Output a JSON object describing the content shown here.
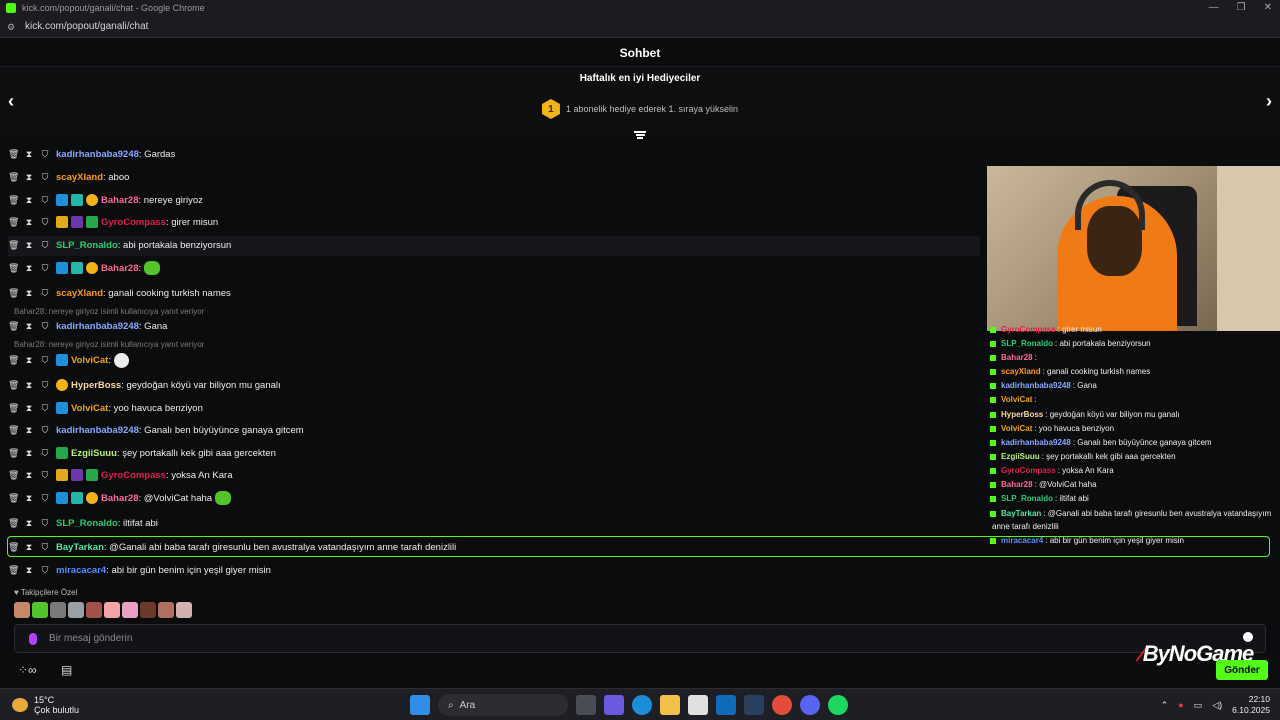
{
  "browser": {
    "window_title": "kick.com/popout/ganali/chat - Google Chrome",
    "url": "kick.com/popout/ganali/chat"
  },
  "header": {
    "title": "Sohbet"
  },
  "gifters": {
    "title": "Haftalık en iyi Hediyeciler",
    "rank": "1",
    "cta": "1 abonelik hediye ederek 1. sıraya yükselin"
  },
  "messages": [
    {
      "user": "kadirhanbaba9248",
      "color": "#8aa8ff",
      "text": ": Gardas"
    },
    {
      "user": "scayXland",
      "color": "#ff9a1f",
      "text": ": aboo"
    },
    {
      "user": "Bahar28",
      "color": "#ff6a95",
      "text": ": nereye giriyoz"
    },
    {
      "user": "GyroCompass",
      "color": "#e01e4d",
      "text": ": girer misun"
    },
    {
      "user": "SLP_Ronaldo",
      "color": "#2ecc71",
      "text": ": abi portakala benziyorsun"
    },
    {
      "user": "Bahar28",
      "color": "#ff6a95",
      "text": ":"
    },
    {
      "user": "scayXland",
      "color": "#ff9a1f",
      "text": ": ganali cooking turkish names"
    },
    {
      "user": "kadirhanbaba9248",
      "color": "#8aa8ff",
      "text": ": Gana"
    },
    {
      "user": "VolviCat",
      "color": "#f0a21a",
      "text": ":"
    },
    {
      "user": "HyperBoss",
      "color": "#ffd7a0",
      "text": ": geydoğan köyü var biliyon mu ganalı"
    },
    {
      "user": "VolviCat",
      "color": "#f0a21a",
      "text": ": yoo havuca benziyon"
    },
    {
      "user": "kadirhanbaba9248",
      "color": "#8aa8ff",
      "text": ": Ganalı ben büyüyünce ganaya gitcem"
    },
    {
      "user": "EzgiiSuuu",
      "color": "#b7f07a",
      "text": ": şey portakallı kek gibi aaa gercekten"
    },
    {
      "user": "GyroCompass",
      "color": "#e01e4d",
      "text": ": yoksa An Kara"
    },
    {
      "user": "Bahar28",
      "color": "#ff6a95",
      "text": ": @VolviCat haha"
    },
    {
      "user": "SLP_Ronaldo",
      "color": "#2ecc71",
      "text": ": iltifat abi"
    },
    {
      "user": "BayTarkan",
      "color": "#55e6a0",
      "text": ": @Ganali abi baba tarafı giresunlu ben avustralya vatandaşıyım anne tarafı denizlili"
    },
    {
      "user": "miracacar4",
      "color": "#5a8bff",
      "text": ": abi bir gün benim için yeşil giyer misin"
    }
  ],
  "replies": [
    "Bahar28: nereye giriyoz isimli kullanıcıya yanıt veriyor",
    "Bahar28: nereye giriyoz isimli kullanıcıya yanıt veriyor"
  ],
  "overlay_chat": [
    {
      "user": "GyroCompass",
      "color": "#e01e4d",
      "text": ": girer misun"
    },
    {
      "user": "SLP_Ronaldo",
      "color": "#2ecc71",
      "text": ": abi portakala benziyorsun"
    },
    {
      "user": "Bahar28",
      "color": "#ff6a95",
      "text": ":"
    },
    {
      "user": "scayXland",
      "color": "#ff9a1f",
      "text": ": ganali cooking turkish names"
    },
    {
      "user": "kadirhanbaba9248",
      "color": "#8aa8ff",
      "text": ": Gana"
    },
    {
      "user": "VolviCat",
      "color": "#f0a21a",
      "text": ":"
    },
    {
      "user": "HyperBoss",
      "color": "#ffd7a0",
      "text": ": geydoğan köyü var biliyon mu ganalı"
    },
    {
      "user": "VolviCat",
      "color": "#f0a21a",
      "text": ": yoo havuca benziyon"
    },
    {
      "user": "kadirhanbaba9248",
      "color": "#8aa8ff",
      "text": ": Ganalı ben büyüyünce ganaya gitcem"
    },
    {
      "user": "EzgiiSuuu",
      "color": "#b7f07a",
      "text": ": şey portakallı kek gibi aaa gercekten"
    },
    {
      "user": "GyroCompass",
      "color": "#e01e4d",
      "text": ": yoksa An Kara"
    },
    {
      "user": "Bahar28",
      "color": "#ff6a95",
      "text": ": @VolviCat haha"
    },
    {
      "user": "SLP_Ronaldo",
      "color": "#2ecc71",
      "text": ": iltifat abi"
    },
    {
      "user": "BayTarkan",
      "color": "#55e6a0",
      "text": ": @Ganali abi baba tarafı giresunlu ben avustralya vatandaşıyım"
    },
    {
      "user": "",
      "color": "#eeeeee",
      "text": "anne tarafı denizlili"
    },
    {
      "user": "miracacar4",
      "color": "#5a8bff",
      "text": ": abi bir gün benim için yeşil giyer misin"
    }
  ],
  "emote_section": {
    "title": "Takipçilere Özel"
  },
  "composer": {
    "placeholder": "Bir mesaj gönderin",
    "send_label": "Gönder"
  },
  "watermark": {
    "mark": "⁄",
    "text": "ByNoGame"
  },
  "taskbar": {
    "temperature": "15°C",
    "weather": "Çok bulutlu",
    "search": "Ara",
    "time": "22:10",
    "date": "6.10.2025"
  }
}
